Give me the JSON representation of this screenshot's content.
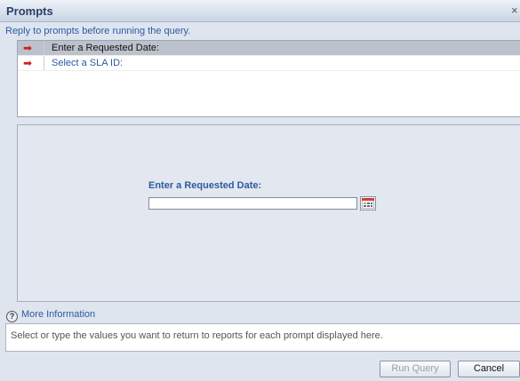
{
  "window": {
    "title": "Prompts",
    "close_glyph": "×"
  },
  "instructions": "Reply to prompts before running the query.",
  "prompts": [
    {
      "label": "Enter a Requested Date:",
      "selected": true,
      "icon": "red-arrow-icon"
    },
    {
      "label": "Select a SLA ID:",
      "selected": false,
      "icon": "red-arrow-icon"
    }
  ],
  "active_prompt": {
    "title": "Enter a Requested Date:",
    "value": ""
  },
  "more_info": {
    "icon": "?",
    "label": "More Information"
  },
  "info_text": "Select or type the values you want to return to reports for each prompt displayed here.",
  "buttons": {
    "run": "Run Query",
    "cancel": "Cancel"
  }
}
